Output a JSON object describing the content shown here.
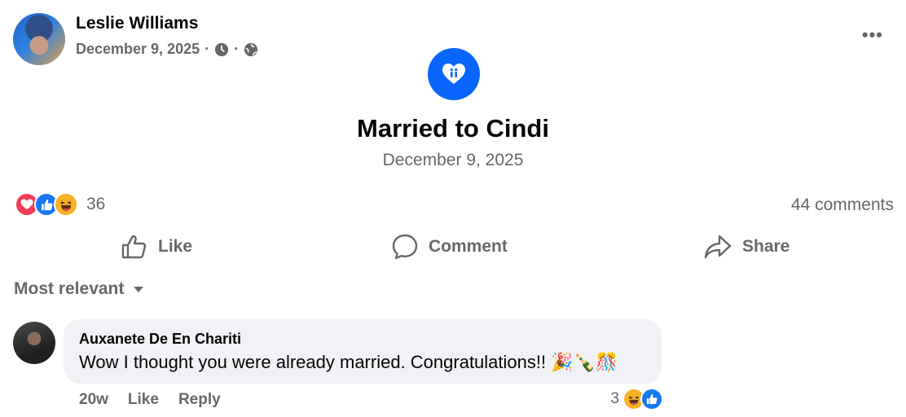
{
  "post": {
    "author": "Leslie Williams",
    "date": "December 9, 2025",
    "separator": "·",
    "more_label": "•••"
  },
  "life_event": {
    "title": "Married to Cindi",
    "date": "December 9, 2025"
  },
  "engagement": {
    "reaction_count": "36",
    "comments_label": "44 comments",
    "reactions": [
      "love",
      "like",
      "haha"
    ]
  },
  "actions": {
    "like": "Like",
    "comment": "Comment",
    "share": "Share"
  },
  "comments_sort": {
    "label": "Most relevant"
  },
  "comment": {
    "author": "Auxanete De En Chariti",
    "text": "Wow I thought you were already married. Congratulations!!",
    "emojis": "🎉🍾🎊",
    "time": "20w",
    "like": "Like",
    "reply": "Reply",
    "reaction_count": "3"
  },
  "colors": {
    "accent": "#0866ff",
    "secondary_text": "#65676b",
    "bubble": "#f0f2f5"
  }
}
